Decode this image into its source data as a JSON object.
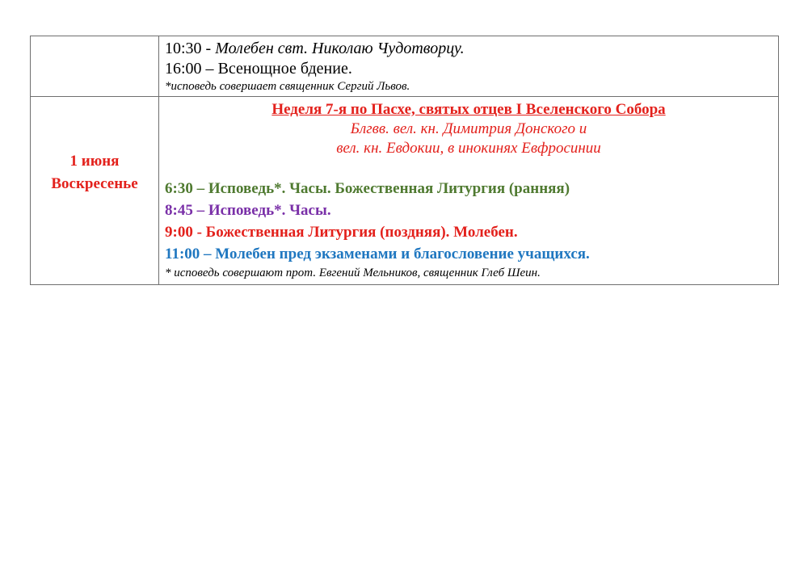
{
  "rows": [
    {
      "date": "",
      "lines": [
        {
          "time": "10:30 - ",
          "text": "Молебен свт. Николаю Чудотворцу."
        },
        {
          "time": "16:00 – ",
          "text": "Всенощное бдение."
        },
        {
          "note": "*исповедь  совершает священник Сергий Львов."
        }
      ]
    },
    {
      "date_line1": "1 июня",
      "date_line2": "Воскресенье",
      "feast": "Неделя 7-я по Пасхе, святых отцев I Вселенского Собора",
      "saints_line1": "Блгвв. вел. кн. Димитрия Донского и",
      "saints_line2": "вел. кн. Евдокии, в инокинях Евфросинии",
      "services": [
        {
          "text": "6:30 – Исповедь*. Часы. Божественная Литургия (ранняя)",
          "color": "#4f7a30"
        },
        {
          "text": "8:45 – Исповедь*. Часы.",
          "color": "#7a30a8"
        },
        {
          "text": "9:00 - Божественная Литургия (поздняя). Молебен.",
          "color": "#e3211c"
        },
        {
          "text": "11:00 – Молебен пред экзаменами и благословение учащихся.",
          "color": "#1f77c0"
        }
      ],
      "note": "* исповедь совершают прот. Евгений Мельников, священник Глеб Шеин."
    }
  ],
  "colors": {
    "accent_red": "#e3211c",
    "border": "#6f6f6f"
  }
}
